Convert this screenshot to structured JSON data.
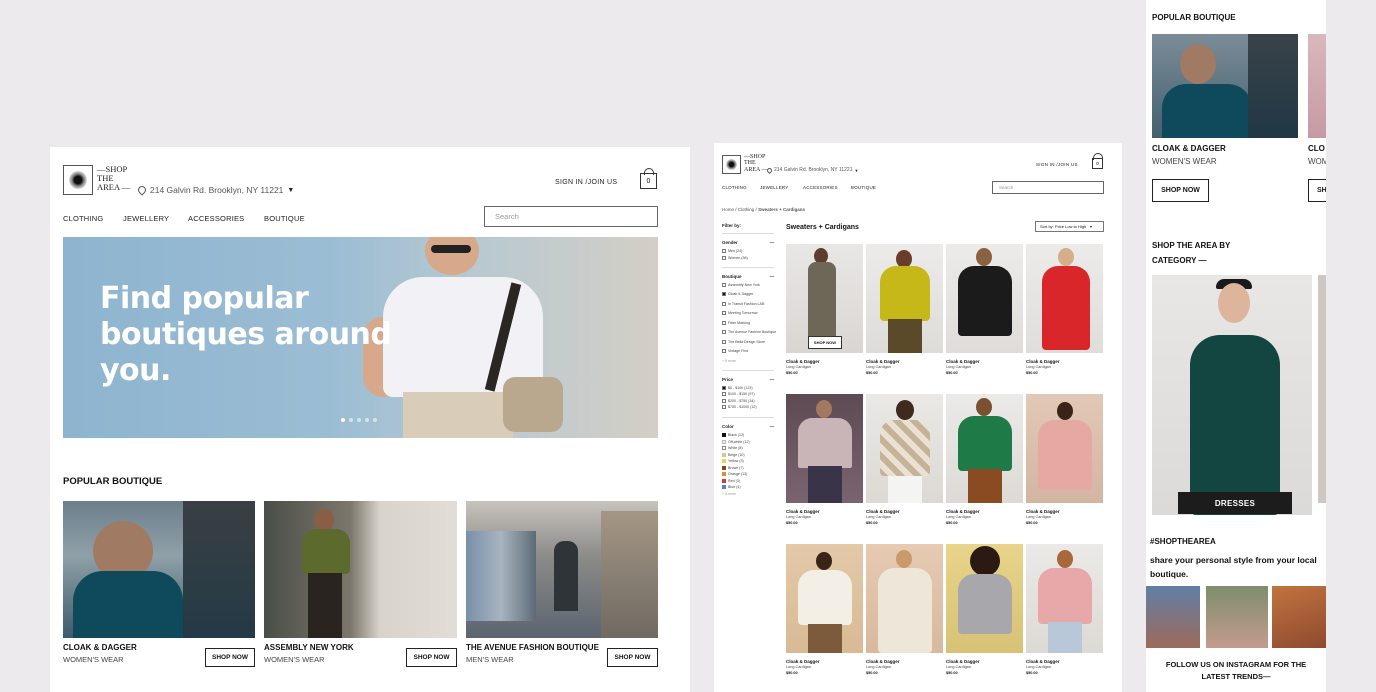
{
  "colors": {
    "background": "#eceaed",
    "text": "#111111",
    "hero_blue": "#9bbdd4",
    "dark_button": "#1c1c1c"
  },
  "brand": {
    "logo_text": "—SHOP\nTHE\nAREA —"
  },
  "header": {
    "address": "214 Galvin Rd. Brooklyn, NY 11221",
    "signin": "SIGN IN /JOIN US",
    "cart_count": "0",
    "search_placeholder": "Search"
  },
  "nav": [
    "CLOTHING",
    "JEWELLERY",
    "ACCESSORIES",
    "BOUTIQUE"
  ],
  "hero": {
    "title": "Find popular boutiques around you.",
    "dots": 5,
    "active_dot": 0
  },
  "popular": {
    "title": "POPULAR BOUTIQUE",
    "cards": [
      {
        "name": "CLOAK & DAGGER",
        "category": "WOMEN'S WEAR",
        "button": "SHOP NOW"
      },
      {
        "name": "ASSEMBLY NEW YORK",
        "category": "WOMEN'S WEAR",
        "button": "SHOP NOW"
      },
      {
        "name": "THE AVENUE FASHION BOUTIQUE",
        "category": "MEN'S WEAR",
        "button": "SHOP NOW"
      }
    ]
  },
  "listing": {
    "breadcrumb": [
      "Home",
      "Clothing",
      "Sweaters + Cardigans"
    ],
    "title": "Sweaters + Cardigans",
    "sort_label": "Sort by: Price Low to High",
    "filter_title": "Filter by:",
    "filters": {
      "gender": {
        "title": "Gender",
        "items": [
          "Men (24)",
          "Women (36)"
        ]
      },
      "boutique": {
        "title": "Boutique",
        "items": [
          "Assembly New York",
          "Cloak & Dagger",
          "In Transit Fashion LAB",
          "Meeting Tomorrow",
          "Fiber Marking",
          "The Avenue Fashion Boutique",
          "The Bella Design Store",
          "Vintage Find"
        ],
        "more": "+ 8 more"
      },
      "price": {
        "title": "Price",
        "items": [
          "$0 - $100 (123)",
          "$100 - $150 (97)",
          "$200 - $750 (34)",
          "$750 - $1000 (12)"
        ]
      },
      "color": {
        "title": "Color",
        "items": [
          {
            "label": "Black (12)",
            "swatch": "#111111"
          },
          {
            "label": "Off-white (12)",
            "swatch": "#f1ede4"
          },
          {
            "label": "White (8)",
            "swatch": "#ffffff"
          },
          {
            "label": "Beige (10)",
            "swatch": "#d8c4a0"
          },
          {
            "label": "Yellow (3)",
            "swatch": "#e6d84a"
          },
          {
            "label": "Brown (7)",
            "swatch": "#7a4b2a"
          },
          {
            "label": "Orange (13)",
            "swatch": "#e2893a"
          },
          {
            "label": "Red (3)",
            "swatch": "#d23a3a"
          },
          {
            "label": "Blue (4)",
            "swatch": "#5a7fd0"
          }
        ],
        "more": "+ 8 more"
      }
    },
    "products": [
      {
        "name": "Cloak & Dagger",
        "desc": "Long Cardigan",
        "price": "$50.00",
        "hover": "SHOP NOW"
      },
      {
        "name": "Cloak & Dagger",
        "desc": "Long Cardigan",
        "price": "$50.00"
      },
      {
        "name": "Cloak & Dagger",
        "desc": "Long Cardigan",
        "price": "$50.00"
      },
      {
        "name": "Cloak & Dagger",
        "desc": "Long Cardigan",
        "price": "$50.00"
      },
      {
        "name": "Cloak & Dagger",
        "desc": "Long Cardigan",
        "price": "$50.00"
      },
      {
        "name": "Cloak & Dagger",
        "desc": "Long Cardigan",
        "price": "$50.00"
      },
      {
        "name": "Cloak & Dagger",
        "desc": "Long Cardigan",
        "price": "$50.00"
      },
      {
        "name": "Cloak & Dagger",
        "desc": "Long Cardigan",
        "price": "$50.00"
      },
      {
        "name": "Cloak & Dagger",
        "desc": "Long Cardigan",
        "price": "$50.00"
      },
      {
        "name": "Cloak & Dagger",
        "desc": "Long Cardigan",
        "price": "$50.00"
      },
      {
        "name": "Cloak & Dagger",
        "desc": "Long Cardigan",
        "price": "$50.00"
      },
      {
        "name": "Cloak & Dagger",
        "desc": "Long Cardigan",
        "price": "$50.00"
      }
    ]
  },
  "mobile": {
    "popular_title": "POPULAR BOUTIQUE",
    "card": {
      "name": "CLOAK & DAGGER",
      "category": "WOMEN'S WEAR",
      "button": "SHOP NOW"
    },
    "peek_name": "CLO",
    "peek_category": "WOM",
    "peek_button": "SH",
    "category_title": "SHOP THE AREA BY CATEGORY —",
    "category_button": "DRESSES",
    "hashtag": "#SHOPTHEAREA",
    "share_text": "share your personal style from your local boutique.",
    "follow_text": "FOLLOW US ON INSTAGRAM FOR THE LATEST TRENDS—"
  }
}
